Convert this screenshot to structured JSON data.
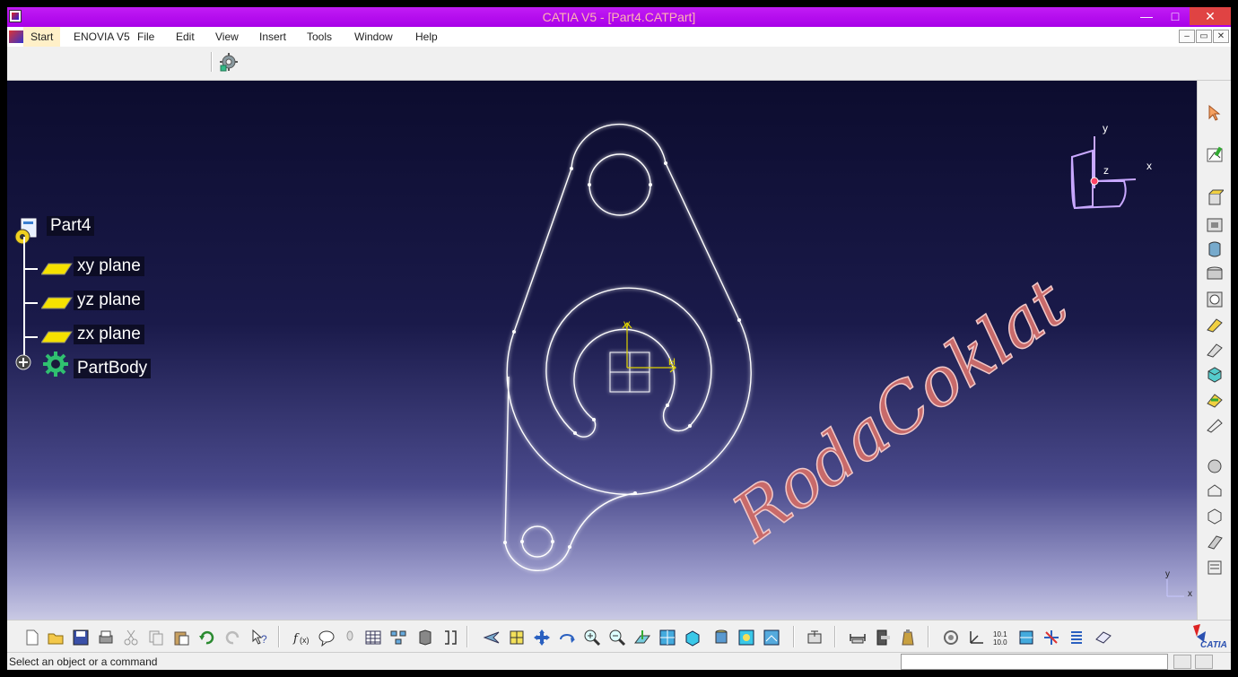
{
  "window": {
    "title": "CATIA V5 - [Part4.CATPart]",
    "controls": {
      "minimize": "—",
      "maximize": "□",
      "close": "✕"
    }
  },
  "menubar": {
    "items": [
      "Start",
      "ENOVIA V5",
      "File",
      "Edit",
      "View",
      "Insert",
      "Tools",
      "Window",
      "Help"
    ],
    "doc_controls": [
      "–",
      "▭",
      "✕"
    ]
  },
  "tree": {
    "root": "Part4",
    "planes": [
      "xy plane",
      "yz plane",
      "zx plane"
    ],
    "body": "PartBody"
  },
  "sketch": {
    "v_axis_label": "V",
    "h_axis_label": "H"
  },
  "compass": {
    "x": "x",
    "y": "y",
    "z": "z"
  },
  "mini_axis": {
    "x": "x",
    "y": "y"
  },
  "watermark": "RodaCoklat",
  "brand": "CATIA",
  "status": {
    "message": "Select an object or a command",
    "command_value": ""
  },
  "colors": {
    "titlebar": "#b40cf0",
    "viewport_top": "#0c0c2e",
    "viewport_bottom": "#c9c9e4",
    "sketch_line": "#ffffff",
    "axis": "#e0d400",
    "compass": "#c8a8ff",
    "watermark_fill": "#c86a6a"
  },
  "icons": {
    "right_toolbar": [
      "select-arrow-icon",
      "sketcher-icon",
      "pad-icon",
      "pocket-icon",
      "shaft-icon",
      "groove-icon",
      "hole-icon",
      "rib-icon",
      "slot-icon",
      "multi-section-solid-icon",
      "removed-multi-section-icon",
      "fillet-icon",
      "chamfer-icon",
      "draft-icon",
      "shell-icon",
      "thickness-icon",
      "thread-icon",
      "split-icon"
    ],
    "bottom_toolbar": [
      "new-icon",
      "open-icon",
      "save-icon",
      "print-icon",
      "cut-icon",
      "copy-icon",
      "paste-icon",
      "undo-icon",
      "redo-icon",
      "whats-this-icon",
      "formula-icon",
      "comment-icon",
      "light-icon",
      "table-icon",
      "hierarchy-icon",
      "catalog-icon",
      "knowledge-icon",
      "fly-mode-icon",
      "fit-all-icon",
      "pan-icon",
      "rotate-icon",
      "zoom-in-icon",
      "zoom-out-icon",
      "normal-view-icon",
      "iso-view-icon",
      "view-mode-icon",
      "shading-icon",
      "hide-show-icon",
      "swap-space-icon",
      "measure-icon",
      "measure-item-icon",
      "mass-icon",
      "apply-material-icon",
      "axis-system-icon",
      "scale-icon",
      "constraint-icon",
      "analysis-icon",
      "stack-icon",
      "publish-icon"
    ]
  }
}
